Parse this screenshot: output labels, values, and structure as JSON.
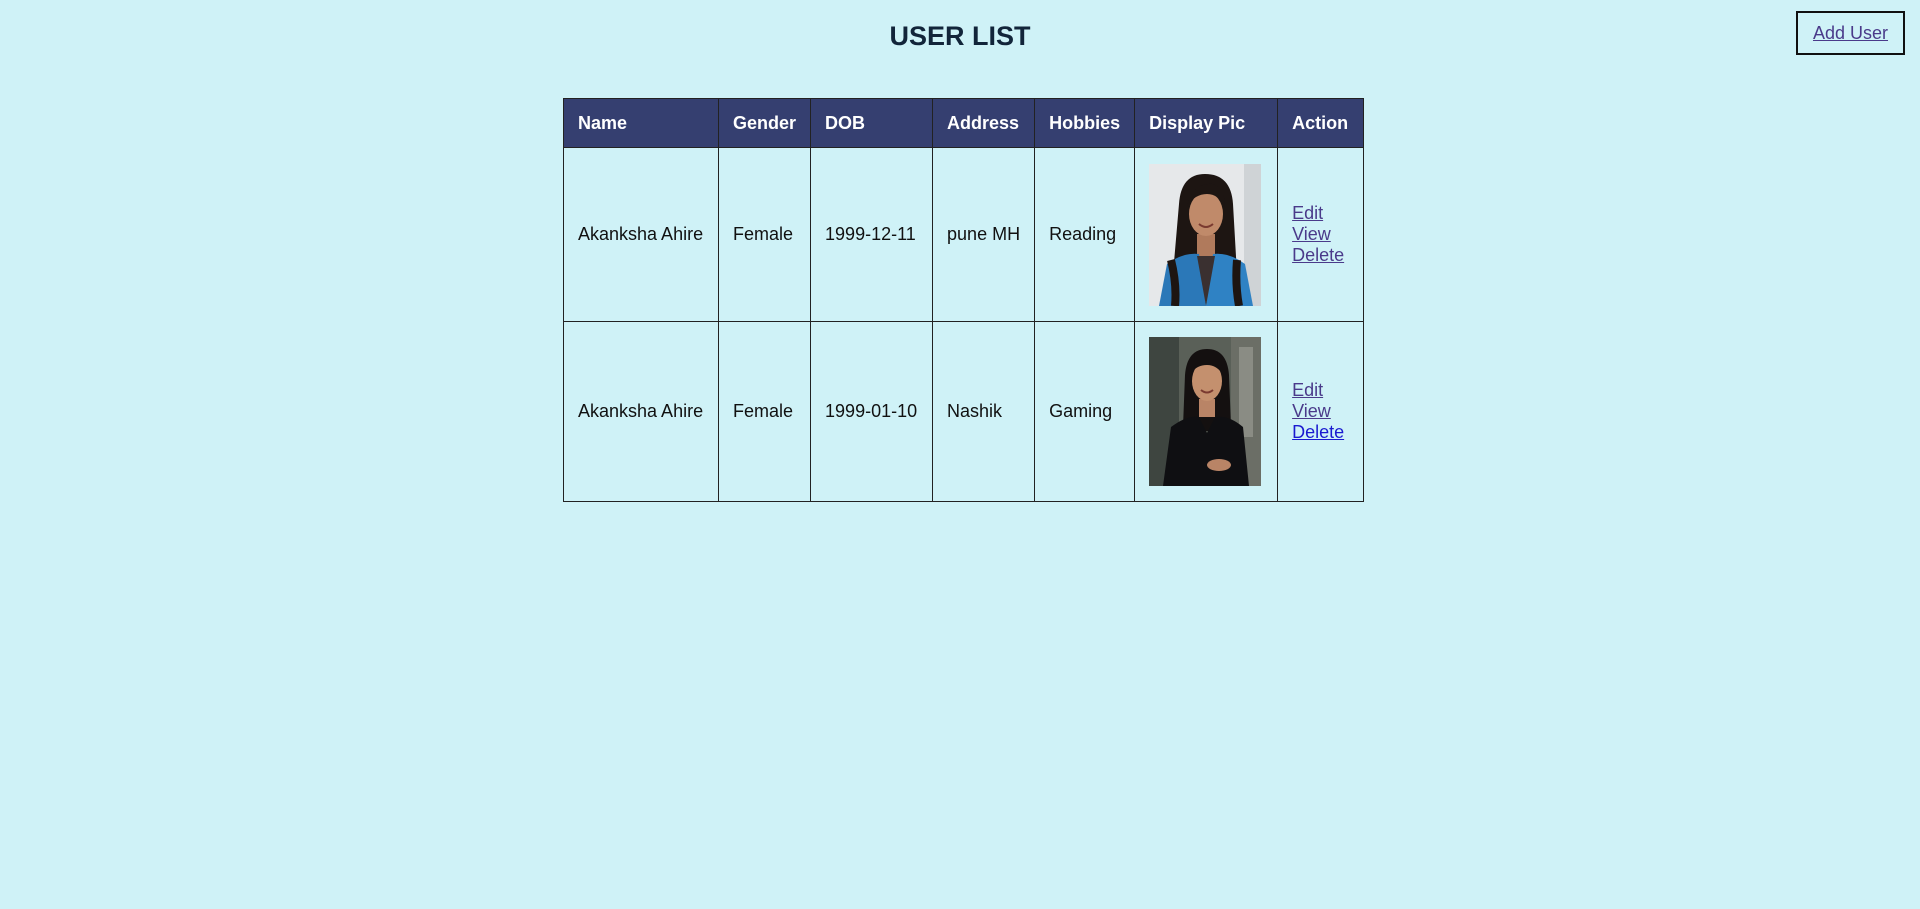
{
  "page": {
    "title": "USER LIST",
    "add_user_label": "Add User"
  },
  "table": {
    "headers": [
      "Name",
      "Gender",
      "DOB",
      "Address",
      "Hobbies",
      "Display Pic",
      "Action"
    ],
    "rows": [
      {
        "name": "Akanksha Ahire",
        "gender": "Female",
        "dob": "1999-12-11",
        "address": "pune MH",
        "hobbies": "Reading",
        "display_pic": "profile-photo-denim-jacket",
        "actions": {
          "edit": "Edit",
          "view": "View",
          "delete": "Delete"
        }
      },
      {
        "name": "Akanksha Ahire",
        "gender": "Female",
        "dob": "1999-01-10",
        "address": "Nashik",
        "hobbies": "Gaming",
        "display_pic": "profile-photo-black-top",
        "actions": {
          "edit": "Edit",
          "view": "View",
          "delete": "Delete"
        }
      }
    ]
  },
  "colors": {
    "background": "#cff2f7",
    "header_bg": "#353f70",
    "header_text": "#ffffff",
    "link": "#4a3a8a",
    "link_active": "#1a1ad0"
  }
}
